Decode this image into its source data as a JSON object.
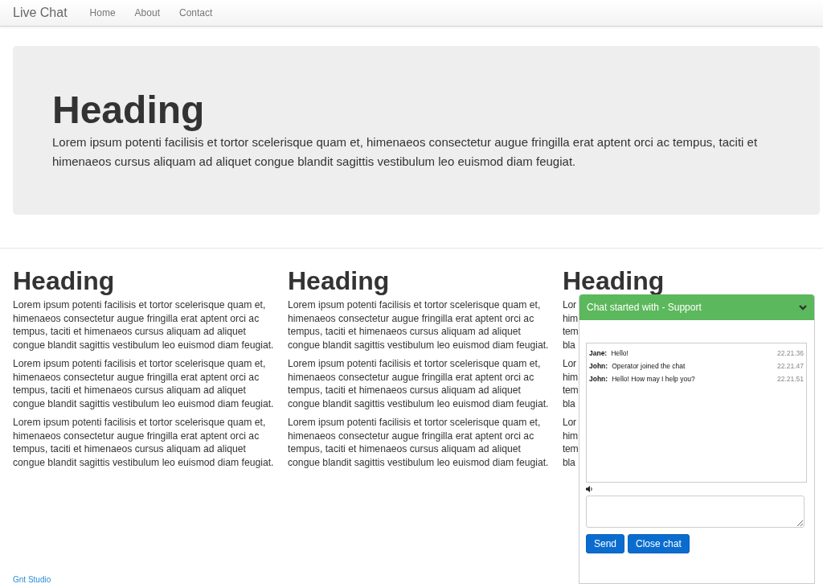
{
  "navbar": {
    "brand": "Live Chat",
    "links": [
      {
        "label": "Home"
      },
      {
        "label": "About"
      },
      {
        "label": "Contact"
      }
    ]
  },
  "jumbotron": {
    "heading": "Heading",
    "text": "Lorem ipsum potenti facilisis et tortor scelerisque quam et, himenaeos consectetur augue fringilla erat aptent orci ac tempus, taciti et himenaeos cursus aliquam ad aliquet congue blandit sagittis vestibulum leo euismod diam feugiat."
  },
  "columns": [
    {
      "heading": "Heading",
      "paragraphs": [
        "Lorem ipsum potenti facilisis et tortor scelerisque quam et, himenaeos consectetur augue fringilla erat aptent orci ac tempus, taciti et himenaeos cursus aliquam ad aliquet congue blandit sagittis vestibulum leo euismod diam feugiat.",
        "Lorem ipsum potenti facilisis et tortor scelerisque quam et, himenaeos consectetur augue fringilla erat aptent orci ac tempus, taciti et himenaeos cursus aliquam ad aliquet congue blandit sagittis vestibulum leo euismod diam feugiat.",
        "Lorem ipsum potenti facilisis et tortor scelerisque quam et, himenaeos consectetur augue fringilla erat aptent orci ac tempus, taciti et himenaeos cursus aliquam ad aliquet congue blandit sagittis vestibulum leo euismod diam feugiat."
      ]
    },
    {
      "heading": "Heading",
      "paragraphs": [
        "Lorem ipsum potenti facilisis et tortor scelerisque quam et, himenaeos consectetur augue fringilla erat aptent orci ac tempus, taciti et himenaeos cursus aliquam ad aliquet congue blandit sagittis vestibulum leo euismod diam feugiat.",
        "Lorem ipsum potenti facilisis et tortor scelerisque quam et, himenaeos consectetur augue fringilla erat aptent orci ac tempus, taciti et himenaeos cursus aliquam ad aliquet congue blandit sagittis vestibulum leo euismod diam feugiat.",
        "Lorem ipsum potenti facilisis et tortor scelerisque quam et, himenaeos consectetur augue fringilla erat aptent orci ac tempus, taciti et himenaeos cursus aliquam ad aliquet congue blandit sagittis vestibulum leo euismod diam feugiat."
      ]
    }
  ],
  "covered_column": {
    "heading": "Heading",
    "paragraphs": [
      [
        {
          "left": "Lor"
        },
        {
          "left": "him"
        },
        {
          "left": "tem"
        },
        {
          "left": "bla"
        }
      ],
      [
        {
          "left": "Lor"
        },
        {
          "left": "him"
        },
        {
          "left": "tem"
        },
        {
          "left": "bla"
        }
      ],
      [
        {
          "left": "Lor"
        },
        {
          "left": "him"
        },
        {
          "left": "tem"
        },
        {
          "left": "bla"
        }
      ]
    ]
  },
  "chat": {
    "title": "Chat started with - Support",
    "expanded": true,
    "messages": [
      {
        "sender": "Jane:",
        "text": "Hello!",
        "time": "22.21.36"
      },
      {
        "sender": "John:",
        "text": "Operator joined the chat",
        "time": "22.21.47"
      },
      {
        "sender": "John:",
        "text": "Hello! How may I help you?",
        "time": "22.21.51"
      }
    ],
    "sound_on": true,
    "buttons": [
      "Send",
      "Close chat"
    ]
  },
  "footer": {
    "link": "Gnt Studio"
  }
}
